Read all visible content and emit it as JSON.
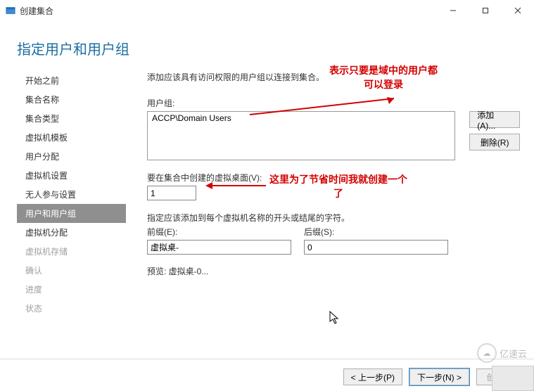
{
  "window": {
    "title": "创建集合",
    "controls": {
      "min": "–",
      "max": "☐",
      "close": "✕"
    }
  },
  "heading": "指定用户和用户组",
  "sidebar": {
    "items": [
      {
        "label": "开始之前"
      },
      {
        "label": "集合名称"
      },
      {
        "label": "集合类型"
      },
      {
        "label": "虚拟机模板"
      },
      {
        "label": "用户分配"
      },
      {
        "label": "虚拟机设置"
      },
      {
        "label": "无人参与设置"
      },
      {
        "label": "用户和用户组"
      },
      {
        "label": "虚拟机分配"
      },
      {
        "label": "虚拟机存储"
      },
      {
        "label": "确认"
      },
      {
        "label": "进度"
      },
      {
        "label": "状态"
      }
    ]
  },
  "main": {
    "desc": "添加应该具有访问权限的用户组以连接到集合。",
    "users_label": "用户组:",
    "users_value": "ACCP\\Domain Users",
    "add_btn": "添加(A)...",
    "remove_btn": "删除(R)",
    "count_label": "要在集合中创建的虚拟桌面(V):",
    "count_value": "1",
    "naming_desc": "指定应该添加到每个虚拟机名称的开头或结尾的字符。",
    "prefix_label": "前缀(E):",
    "prefix_value": "虚拟桌-",
    "suffix_label": "后缀(S):",
    "suffix_value": "0",
    "preview_label": "预览: ",
    "preview_value": "虚拟桌-0..."
  },
  "footer": {
    "prev": "< 上一步(P)",
    "next": "下一步(N) >",
    "create": "创建(C)"
  },
  "annotations": {
    "top": "表示只要是域中的用户都\n可以登录",
    "mid": "这里为了节省时间我就创建一个\n了"
  },
  "watermark": "亿速云"
}
